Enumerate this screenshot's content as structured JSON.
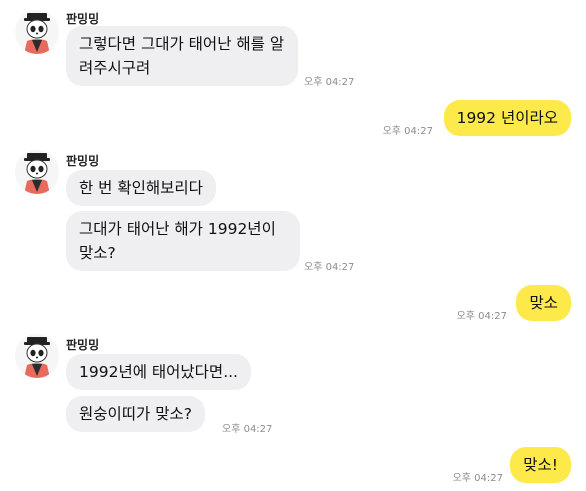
{
  "chat": {
    "sender_name": "판밍밍",
    "groups": [
      {
        "sender": "판밍밍",
        "messages": [
          {
            "text": "그렇다면 그대가 태어난 해를 알려주시구려",
            "time": "오후 04:27"
          }
        ]
      },
      {
        "sender": "me",
        "messages": [
          {
            "text": "1992 년이라오",
            "time": "오후 04:27"
          }
        ]
      },
      {
        "sender": "판밍밍",
        "messages": [
          {
            "text": "한 번 확인해보리다"
          },
          {
            "text": "그대가 태어난 해가 1992년이 맞소?",
            "time": "오후 04:27"
          }
        ]
      },
      {
        "sender": "me",
        "messages": [
          {
            "text": "맞소",
            "time": "오후 04:27"
          }
        ]
      },
      {
        "sender": "판밍밍",
        "messages": [
          {
            "text": "1992년에 태어났다면..."
          },
          {
            "text": "원숭이띠가 맞소?",
            "time": "오후 04:27"
          }
        ]
      },
      {
        "sender": "me",
        "messages": [
          {
            "text": "맞소!",
            "time": "오후 04:27"
          }
        ]
      }
    ]
  },
  "colors": {
    "incoming_bubble": "#efeff2",
    "outgoing_bubble": "#fee94a",
    "timestamp": "#8c8c8c"
  },
  "icons": {
    "avatar": "panda-bot-avatar-icon"
  }
}
